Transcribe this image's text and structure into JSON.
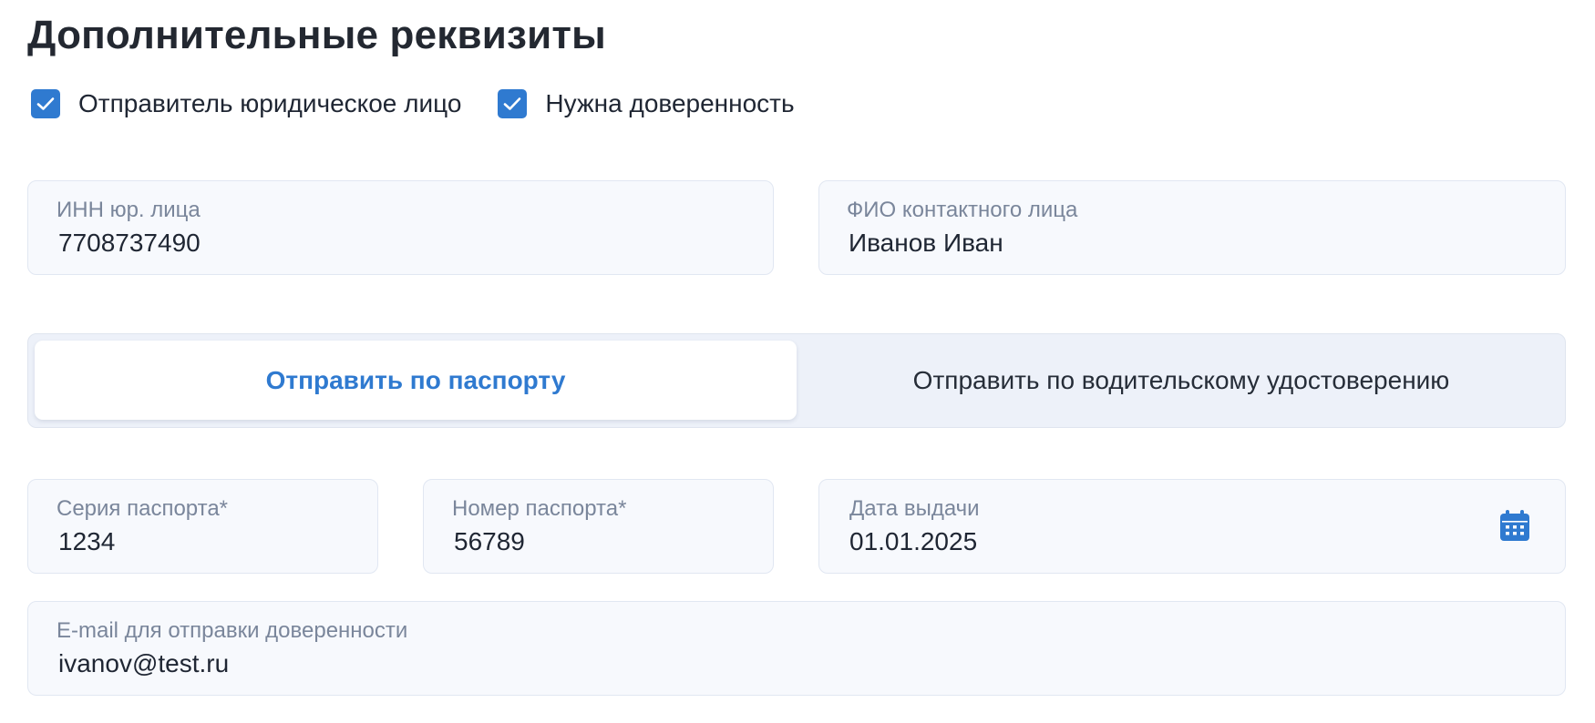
{
  "section": {
    "title": "Дополнительные реквизиты"
  },
  "checkboxes": [
    {
      "label": "Отправитель юридическое лицо",
      "checked": true
    },
    {
      "label": "Нужна доверенность",
      "checked": true
    }
  ],
  "fields": {
    "inn": {
      "label": "ИНН юр. лица",
      "value": "7708737490"
    },
    "contact_name": {
      "label": "ФИО контактного лица",
      "value": "Иванов Иван"
    },
    "passport_series": {
      "label": "Серия паспорта*",
      "value": "1234"
    },
    "passport_number": {
      "label": "Номер паспорта*",
      "value": "56789"
    },
    "issue_date": {
      "label": "Дата выдачи",
      "value": "01.01.2025"
    },
    "email": {
      "label": "E-mail для отправки доверенности",
      "value": "ivanov@test.ru"
    }
  },
  "document_toggle": {
    "options": [
      {
        "label": "Отправить по паспорту",
        "selected": true
      },
      {
        "label": "Отправить по водительскому удостоверению",
        "selected": false
      }
    ]
  },
  "icons": {
    "checkbox": "check-icon",
    "date_picker": "calendar-icon"
  },
  "colors": {
    "accent": "#2f7ad0",
    "field_background": "#f7f9fd",
    "field_border": "#e1e7f2",
    "toggle_background": "#edf1f9",
    "label_text": "#7a869b",
    "value_text": "#1f2633"
  }
}
